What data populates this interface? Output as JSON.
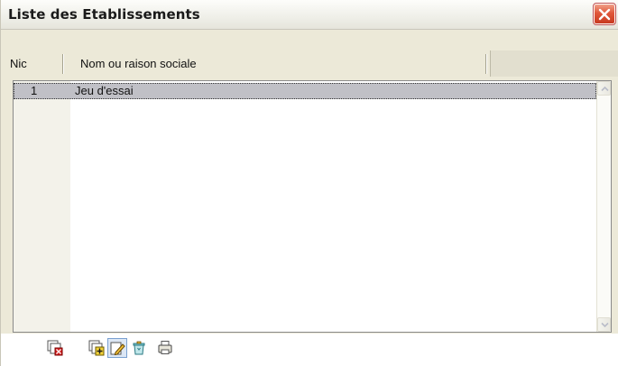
{
  "window": {
    "title": "Liste des Etablissements",
    "close_icon": "close-icon"
  },
  "table": {
    "columns": [
      "Nic",
      "Nom ou raison sociale"
    ],
    "rows": [
      {
        "nic": "1",
        "name": "Jeu d'essai",
        "selected": true
      }
    ]
  },
  "toolbar": {
    "icons": [
      "delete-icon",
      "add-icon",
      "edit-icon",
      "recycle-icon",
      "print-icon"
    ],
    "active": "edit-icon"
  },
  "colors": {
    "close_button": "#e0573a",
    "selection": "#c0c0c6",
    "window_face": "#ece9d8"
  }
}
